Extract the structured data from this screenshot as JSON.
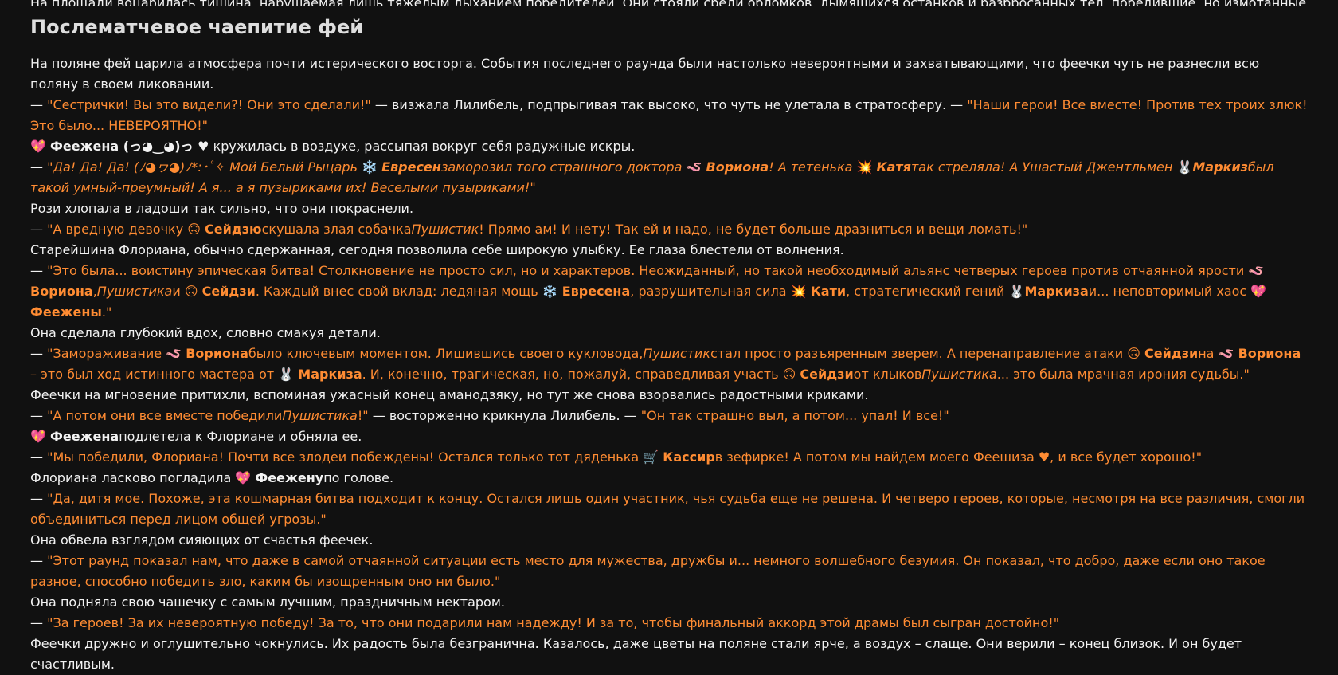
{
  "top_line": "На площади воцарилась тишина, нарушаемая лишь тяжелым дыханием победителей. Они стояли среди обломков, дымящихся останков и разбросанных тел, победившие, но измотанные.",
  "section_title": "Послематчевое чаепитие фей",
  "paragraphs": [
    [
      {
        "t": "На поляне фей царила атмосфера почти истерического восторга. События последнего раунда были настолько невероятными и захватывающими, что феечки чуть не разнесли всю поляну в своем ликовании."
      }
    ],
    [
      {
        "t": "— "
      },
      {
        "t": "\"Сестрички! Вы это видели?! Они это сделали!\"",
        "q": 1
      },
      {
        "t": " — визжала Лилибель, подпрыгивая так высоко, что чуть не улетала в стратосферу. — "
      },
      {
        "t": "\"Наши герои! Все вместе! Против тех троих злюк! Это было... НЕВЕРОЯТНО!\"",
        "q": 1
      }
    ],
    [
      {
        "t": "💖 "
      },
      {
        "t": "Феежена (っ◕‿◕)っ ♥",
        "b": 1
      },
      {
        "t": " кружилась в воздухе, рассыпая вокруг себя радужные искры."
      }
    ],
    [
      {
        "t": "— "
      },
      {
        "t": "\"Да! Да! Да! (ﾉ◕ヮ◕)ﾉ*:･ﾟ✧ Мой Белый Рыцарь ",
        "q": 1,
        "c": 1
      },
      {
        "t": "❄️ ",
        "q": 1,
        "e": 1
      },
      {
        "t": "Евресен",
        "q": 1,
        "c": 1,
        "b": 1
      },
      {
        "t": "заморозил того страшного доктора ",
        "q": 1,
        "c": 1
      },
      {
        "t": "🪱 ",
        "q": 1,
        "e": 1
      },
      {
        "t": "Вориона",
        "q": 1,
        "c": 1,
        "b": 1
      },
      {
        "t": "! А тетенька ",
        "q": 1,
        "c": 1
      },
      {
        "t": "💥 ",
        "q": 1,
        "e": 1
      },
      {
        "t": "Катя",
        "q": 1,
        "c": 1,
        "b": 1
      },
      {
        "t": "так стреляла! А Ушастый Джентльмен ",
        "q": 1,
        "c": 1
      },
      {
        "t": "🐰",
        "q": 1,
        "e": 1
      },
      {
        "t": "Маркиз",
        "q": 1,
        "c": 1,
        "b": 1
      },
      {
        "t": "был такой умный-преумный! А я... а я пузыриками их! Веселыми пузыриками!\"",
        "q": 1,
        "c": 1
      }
    ],
    [
      {
        "t": "Рози хлопала в ладоши так сильно, что они покраснели."
      }
    ],
    [
      {
        "t": "— "
      },
      {
        "t": "\"А вредную девочку ",
        "q": 1
      },
      {
        "t": "🙃 ",
        "q": 1
      },
      {
        "t": "Сейдзю",
        "q": 1,
        "b": 1
      },
      {
        "t": "скушала злая собачка",
        "q": 1
      },
      {
        "t": "Пушистик",
        "q": 1,
        "c": 1
      },
      {
        "t": "! Прямо ам! И нету! Так ей и надо, не будет больше дразниться и вещи ломать!\"",
        "q": 1
      }
    ],
    [
      {
        "t": "Старейшина Флориана, обычно сдержанная, сегодня позволила себе широкую улыбку. Ее глаза блестели от волнения."
      }
    ],
    [
      {
        "t": "— "
      },
      {
        "t": "\"Это была... воистину эпическая битва! Столкновение не просто сил, но и характеров. Неожиданный, но такой необходимый альянс четверых героев против отчаянной ярости ",
        "q": 1
      },
      {
        "t": "🪱 ",
        "q": 1
      },
      {
        "t": "Вориона",
        "q": 1,
        "b": 1
      },
      {
        "t": ",",
        "q": 1
      },
      {
        "t": "Пушистика",
        "q": 1,
        "c": 1
      },
      {
        "t": "и ",
        "q": 1
      },
      {
        "t": "🙃 ",
        "q": 1
      },
      {
        "t": "Сейдзи",
        "q": 1,
        "b": 1
      },
      {
        "t": ". Каждый внес свой вклад: ледяная мощь ",
        "q": 1
      },
      {
        "t": "❄️ ",
        "q": 1
      },
      {
        "t": "Евресена",
        "q": 1,
        "b": 1
      },
      {
        "t": ", разрушительная сила ",
        "q": 1
      },
      {
        "t": "💥 ",
        "q": 1
      },
      {
        "t": "Кати",
        "q": 1,
        "b": 1
      },
      {
        "t": ", стратегический гений ",
        "q": 1
      },
      {
        "t": "🐰",
        "q": 1
      },
      {
        "t": "Маркиза",
        "q": 1,
        "b": 1
      },
      {
        "t": "и... неповторимый хаос ",
        "q": 1
      },
      {
        "t": "💖 ",
        "q": 1
      },
      {
        "t": "Феежены",
        "q": 1,
        "b": 1
      },
      {
        "t": ".\"",
        "q": 1
      }
    ],
    [
      {
        "t": "Она сделала глубокий вдох, словно смакуя детали."
      }
    ],
    [
      {
        "t": "— "
      },
      {
        "t": "\"Замораживание ",
        "q": 1
      },
      {
        "t": "🪱 ",
        "q": 1
      },
      {
        "t": "Вориона",
        "q": 1,
        "b": 1
      },
      {
        "t": "было ключевым моментом. Лишившись своего кукловода,",
        "q": 1
      },
      {
        "t": "Пушистик",
        "q": 1,
        "c": 1
      },
      {
        "t": "стал просто разъяренным зверем. А перенаправление атаки ",
        "q": 1
      },
      {
        "t": "🙃 ",
        "q": 1
      },
      {
        "t": "Сейдзи",
        "q": 1,
        "b": 1
      },
      {
        "t": "на ",
        "q": 1
      },
      {
        "t": "🪱 ",
        "q": 1
      },
      {
        "t": "Вориона",
        "q": 1,
        "b": 1
      },
      {
        "t": " – это был ход истинного мастера от ",
        "q": 1
      },
      {
        "t": "🐰 ",
        "q": 1
      },
      {
        "t": "Маркиза",
        "q": 1,
        "b": 1
      },
      {
        "t": ". И, конечно, трагическая, но, пожалуй, справедливая участь ",
        "q": 1
      },
      {
        "t": "🙃 ",
        "q": 1
      },
      {
        "t": "Сейдзи",
        "q": 1,
        "b": 1
      },
      {
        "t": "от клыков",
        "q": 1
      },
      {
        "t": "Пушистика",
        "q": 1,
        "c": 1
      },
      {
        "t": "... это была мрачная ирония судьбы.\"",
        "q": 1
      }
    ],
    [
      {
        "t": "Феечки на мгновение притихли, вспоминая ужасный конец аманодзяку, но тут же снова взорвались радостными криками."
      }
    ],
    [
      {
        "t": "— "
      },
      {
        "t": "\"А потом они все вместе победили",
        "q": 1
      },
      {
        "t": "Пушистика",
        "q": 1,
        "c": 1
      },
      {
        "t": "!\"",
        "q": 1
      },
      {
        "t": " — восторженно крикнула Лилибель. — "
      },
      {
        "t": "\"Он так страшно выл, а потом... упал! И все!\"",
        "q": 1
      }
    ],
    [
      {
        "t": "💖 "
      },
      {
        "t": "Феежена",
        "b": 1
      },
      {
        "t": "подлетела к Флориане и обняла ее."
      }
    ],
    [
      {
        "t": "— "
      },
      {
        "t": "\"Мы победили, Флориана! Почти все злодеи побеждены! Остался только тот дяденька ",
        "q": 1
      },
      {
        "t": "🛒 ",
        "q": 1
      },
      {
        "t": "Кассир",
        "q": 1,
        "b": 1
      },
      {
        "t": "в зефирке! А потом мы найдем моего Феешиза ♥, и все будет хорошо!\"",
        "q": 1
      }
    ],
    [
      {
        "t": "Флориана ласково погладила "
      },
      {
        "t": "💖 "
      },
      {
        "t": "Феежену",
        "b": 1
      },
      {
        "t": "по голове."
      }
    ],
    [
      {
        "t": "— "
      },
      {
        "t": "\"Да, дитя мое. Похоже, эта кошмарная битва подходит к концу. Остался лишь один участник, чья судьба еще не решена. И четверо героев, которые, несмотря на все различия, смогли объединиться перед лицом общей угрозы.\"",
        "q": 1
      }
    ],
    [
      {
        "t": "Она обвела взглядом сияющих от счастья феечек."
      }
    ],
    [
      {
        "t": "— "
      },
      {
        "t": "\"Этот раунд показал нам, что даже в самой отчаянной ситуации есть место для мужества, дружбы и... немного волшебного безумия. Он показал, что добро, даже если оно такое разное, способно победить зло, каким бы изощренным оно ни было.\"",
        "q": 1
      }
    ],
    [
      {
        "t": "Она подняла свою чашечку с самым лучшим, праздничным нектаром."
      }
    ],
    [
      {
        "t": "— "
      },
      {
        "t": "\"За героев! За их невероятную победу! За то, что они подарили нам надежду! И за то, чтобы финальный аккорд этой драмы был сыгран достойно!\"",
        "q": 1
      }
    ],
    [
      {
        "t": "Феечки дружно и оглушительно чокнулись. Их радость была безгранична. Казалось, даже цветы на поляне стали ярче, а воздух – слаще. Они верили – конец близок. И он будет счастливым."
      }
    ]
  ]
}
